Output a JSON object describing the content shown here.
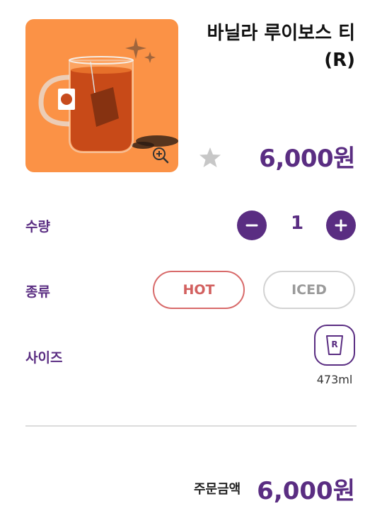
{
  "product": {
    "name": "바닐라 루이보스 티(R)",
    "price": "6,000원",
    "image_alt": "Tea in glass mug",
    "favorite_icon": "star-icon",
    "zoom_icon": "zoom-in-icon"
  },
  "options": {
    "quantity": {
      "label": "수량",
      "value": "1",
      "minus_icon": "minus-icon",
      "plus_icon": "plus-icon"
    },
    "temperature": {
      "label": "종류",
      "hot": "HOT",
      "iced": "ICED",
      "selected": "HOT"
    },
    "size": {
      "label": "사이즈",
      "icon_letter": "R",
      "volume": "473ml"
    }
  },
  "summary": {
    "label": "주문금액",
    "total": "6,000원"
  },
  "colors": {
    "brand": "#5a2d82",
    "hot": "#d2605f",
    "image_bg": "#fb9246",
    "star": "#c7c7c7"
  }
}
